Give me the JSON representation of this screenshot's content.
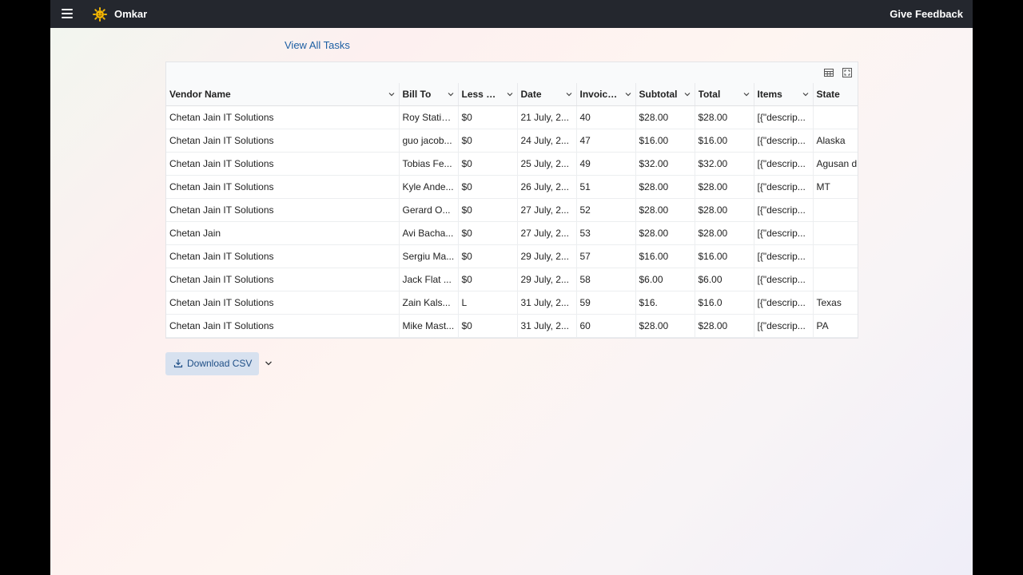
{
  "topbar": {
    "brand": "Omkar",
    "feedback_label": "Give Feedback"
  },
  "view_all_tasks": "View All Tasks",
  "grid": {
    "columns": [
      "Vendor Name",
      "Bill To",
      "Less Di...",
      "Date",
      "Invoice...",
      "Subtotal",
      "Total",
      "Items",
      "State"
    ],
    "rows": [
      [
        "Chetan Jain IT Solutions",
        "Roy Statio...",
        "$0",
        "21 July, 2...",
        "40",
        "$28.00",
        "$28.00",
        "[{\"descrip...",
        ""
      ],
      [
        "Chetan Jain IT Solutions",
        "guo jacob...",
        "$0",
        "24 July, 2...",
        "47",
        "$16.00",
        "$16.00",
        "[{\"descrip...",
        "Alaska"
      ],
      [
        "Chetan Jain IT Solutions",
        "Tobias Fe...",
        "$0",
        "25 July, 2...",
        "49",
        "$32.00",
        "$32.00",
        "[{\"descrip...",
        "Agusan d"
      ],
      [
        "Chetan Jain IT Solutions",
        "Kyle Ande...",
        "$0",
        "26 July, 2...",
        "51",
        "$28.00",
        "$28.00",
        "[{\"descrip...",
        "MT"
      ],
      [
        "Chetan Jain IT Solutions",
        "Gerard O...",
        "$0",
        "27 July, 2...",
        "52",
        "$28.00",
        "$28.00",
        "[{\"descrip...",
        ""
      ],
      [
        "Chetan Jain",
        "Avi Bacha...",
        "$0",
        "27 July, 2...",
        "53",
        "$28.00",
        "$28.00",
        "[{\"descrip...",
        ""
      ],
      [
        "Chetan Jain IT Solutions",
        "Sergiu Ma...",
        "$0",
        "29 July, 2...",
        "57",
        "$16.00",
        "$16.00",
        "[{\"descrip...",
        ""
      ],
      [
        "Chetan Jain IT Solutions",
        "Jack Flat ...",
        "$0",
        "29 July, 2...",
        "58",
        "$6.00",
        "$6.00",
        "[{\"descrip...",
        ""
      ],
      [
        "Chetan Jain IT Solutions",
        "Zain Kals...",
        "L",
        "31 July, 2...",
        "59",
        "$16.",
        "$16.0",
        "[{\"descrip...",
        "Texas"
      ],
      [
        "Chetan Jain IT Solutions",
        "Mike Mast...",
        "$0",
        "31 July, 2...",
        "60",
        "$28.00",
        "$28.00",
        "[{\"descrip...",
        "PA"
      ]
    ]
  },
  "download": {
    "label": "Download CSV"
  },
  "icons": {
    "menu": "hamburger-icon",
    "logo": "sun-icon",
    "columns": "table-columns-icon",
    "fullscreen": "fullscreen-icon",
    "download": "download-icon",
    "more": "chevron-down-icon"
  },
  "colors": {
    "topbar": "#24272e",
    "link": "#1d5fa3",
    "button_bg": "#d7e1ef",
    "logo": "#f2b705"
  }
}
